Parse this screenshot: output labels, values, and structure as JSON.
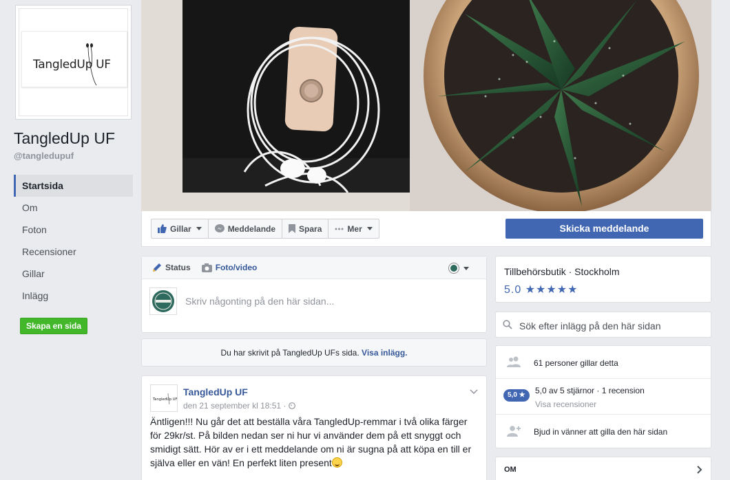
{
  "page": {
    "name": "TangledUp UF",
    "handle": "@tangledupuf",
    "logo_text": "TangledUp UF"
  },
  "left_nav": {
    "items": [
      {
        "label": "Startsida",
        "active": true
      },
      {
        "label": "Om"
      },
      {
        "label": "Foton"
      },
      {
        "label": "Recensioner"
      },
      {
        "label": "Gillar"
      },
      {
        "label": "Inlägg"
      }
    ],
    "create_page": "Skapa en sida"
  },
  "actions": {
    "like": "Gillar",
    "message": "Meddelande",
    "save": "Spara",
    "more": "Mer",
    "send_message": "Skicka meddelande"
  },
  "composer": {
    "status": "Status",
    "photo_video": "Foto/video",
    "placeholder": "Skriv någonting på den här sidan..."
  },
  "notice": {
    "text": "Du har skrivit på TangledUp UFs sida.",
    "link": "Visa inlägg."
  },
  "post": {
    "author": "TangledUp UF",
    "date": "den 21 september kl 18:51 ·",
    "text": "Äntligen!!! Nu går det att beställa våra TangledUp-remmar i två olika färger för 29kr/st. På bilden nedan ser ni hur vi använder dem på ett snyggt och smidigt sätt. Hör av er i ett meddelande om ni är sugna på att köpa en till er själva eller en vän! En perfekt liten present"
  },
  "info": {
    "category": "Tillbehörsbutik · Stockholm",
    "rating": "5.0 ★★★★★"
  },
  "search": {
    "placeholder": "Sök efter inlägg på den här sidan"
  },
  "stats": {
    "likes": "61 personer gillar detta",
    "rating_pill": "5,0 ★",
    "rating_text": "5,0 av 5 stjärnor · 1 recension",
    "rating_link": "Visa recensioner",
    "invite": "Bjud in vänner att gilla den här sidan"
  },
  "about": {
    "title": "OM"
  },
  "colors": {
    "brand_blue": "#4267b2",
    "green": "#42b72a",
    "background": "#e9ebee"
  }
}
